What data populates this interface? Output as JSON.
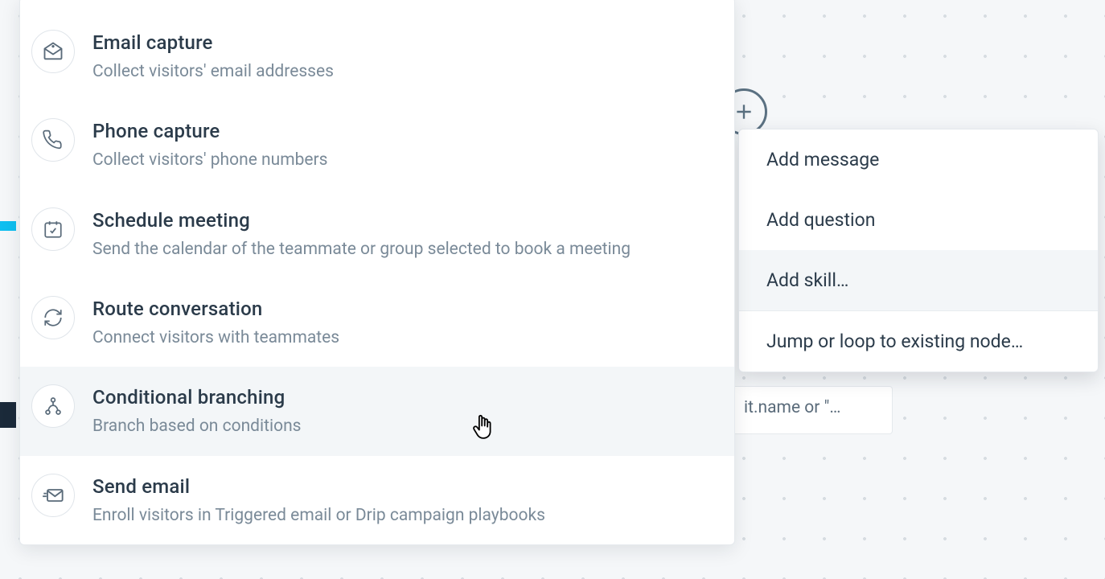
{
  "skills": {
    "items": [
      {
        "icon": "mail-open-icon",
        "title": "Email capture",
        "desc": "Collect visitors' email addresses"
      },
      {
        "icon": "phone-icon",
        "title": "Phone capture",
        "desc": "Collect visitors' phone numbers"
      },
      {
        "icon": "calendar-icon",
        "title": "Schedule meeting",
        "desc": "Send the calendar of the teammate or group selected to book a meeting"
      },
      {
        "icon": "refresh-icon",
        "title": "Route conversation",
        "desc": "Connect visitors with teammates"
      },
      {
        "icon": "branch-icon",
        "title": "Conditional branching",
        "desc": "Branch based on conditions",
        "hovered": true
      },
      {
        "icon": "send-mail-icon",
        "title": "Send email",
        "desc": "Enroll visitors in Triggered email or Drip campaign playbooks"
      }
    ]
  },
  "add_menu": {
    "items": [
      {
        "label": "Add message"
      },
      {
        "label": "Add question"
      },
      {
        "label": "Add skill…",
        "hovered": true
      },
      {
        "label": "Jump or loop to existing node…"
      }
    ]
  },
  "plus_node_label": "+",
  "node_card_text": "it.name or \"…"
}
